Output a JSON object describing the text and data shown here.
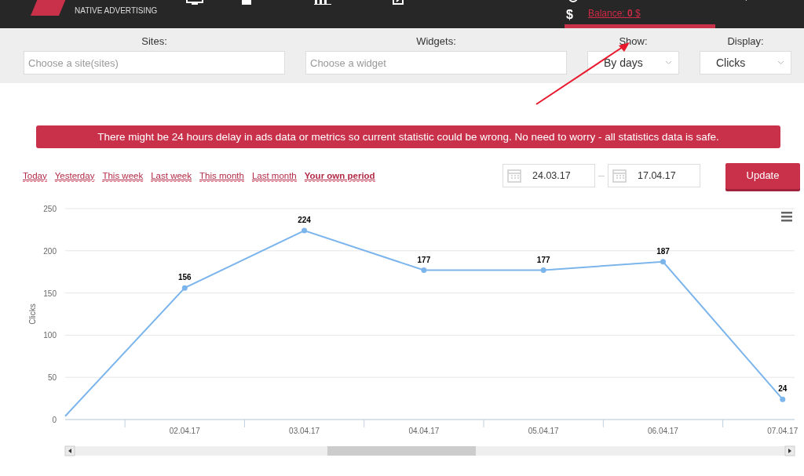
{
  "header": {
    "logo_tagline": "NATIVE ADVERTISING",
    "currency_symbol": "$",
    "balance": "Balance: **0** $"
  },
  "filters": {
    "sites": {
      "label": "Sites:",
      "placeholder": "Choose a site(sites)"
    },
    "widgets": {
      "label": "Widgets:",
      "placeholder": "Choose a widget"
    },
    "show": {
      "label": "Show:",
      "value": "By days"
    },
    "display": {
      "label": "Display:",
      "value": "Clicks"
    }
  },
  "alert": "There might be 24 hours delay in ads data or metrics so current statistic could be wrong. No need to worry - all statistics data is safe.",
  "periods": [
    {
      "label": "Today",
      "selected": false
    },
    {
      "label": "Yesterday",
      "selected": false
    },
    {
      "label": "This week",
      "selected": false
    },
    {
      "label": "Last week",
      "selected": false
    },
    {
      "label": "This month",
      "selected": false
    },
    {
      "label": "Last month",
      "selected": false
    },
    {
      "label": "Your own period",
      "selected": true
    }
  ],
  "date_from": "24.03.17",
  "date_to": "17.04.17",
  "update_button": "Update",
  "chart": {
    "chart_data": {
      "type": "line",
      "ylabel": "Clicks",
      "categories": [
        null,
        "02.04.17",
        "03.04.17",
        "04.04.17",
        "05.04.17",
        "06.04.17",
        "07.04.17"
      ],
      "ylim": [
        0,
        250
      ],
      "yticks": [
        0,
        50,
        100,
        150,
        200,
        250
      ],
      "grid": true,
      "series": [
        {
          "color": "#7cb5ec",
          "marker": true,
          "values": [
            4,
            156,
            224,
            177,
            177,
            187,
            24
          ]
        }
      ],
      "value_labels": [
        null,
        "156",
        "224",
        "177",
        "177",
        "187",
        "24"
      ]
    }
  }
}
